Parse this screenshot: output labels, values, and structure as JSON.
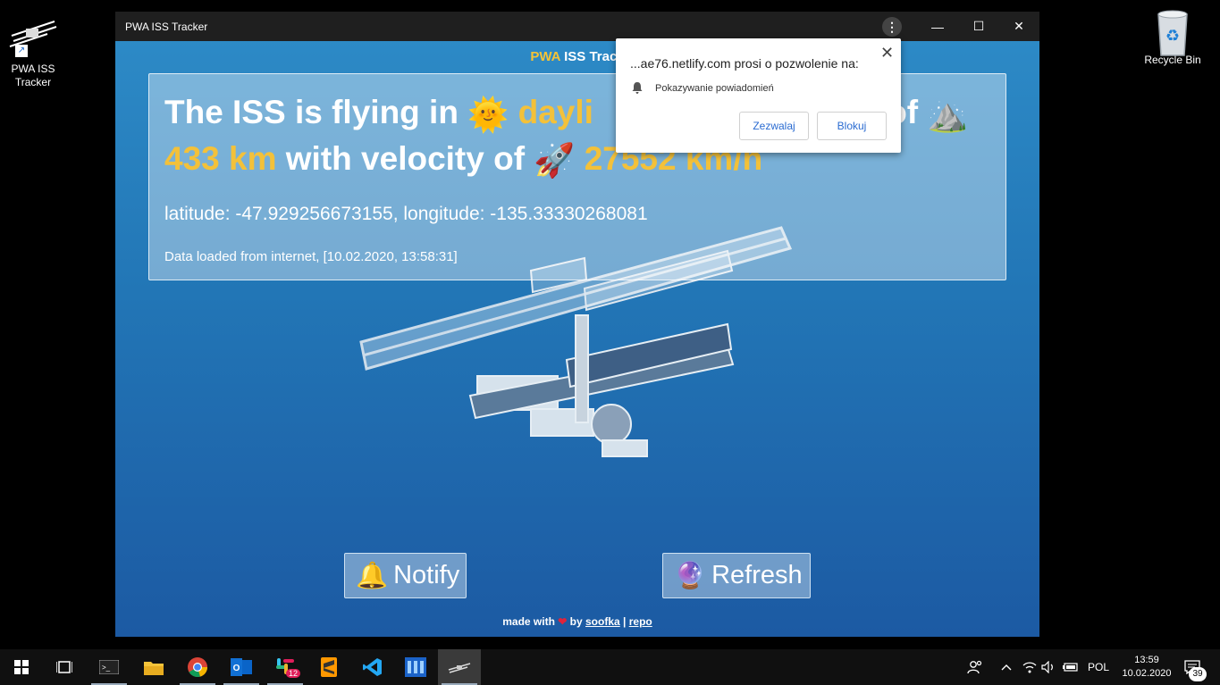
{
  "desktop": {
    "icons": [
      {
        "label_line1": "PWA ISS",
        "label_line2": "Tracker"
      },
      {
        "label_line1": "Recycle Bin"
      }
    ]
  },
  "window": {
    "title": "PWA ISS Tracker",
    "controls": {
      "menu": "⋮",
      "minimize": "—",
      "maximize": "☐",
      "close": "✕"
    }
  },
  "app": {
    "header_prefix": "PWA",
    "header_rest": " ISS Track",
    "headline": {
      "part1": "The ISS is flying in ",
      "daylight_emoji": "🌞",
      "daylight": "dayli",
      "part2": "of ",
      "mountain_emoji": "⛰️",
      "altitude": "433 km",
      "part3": " with velocity of ",
      "rocket_emoji": "🚀",
      "velocity": "27552 km/h"
    },
    "coordinates": "latitude: -47.929256673155, longitude: -135.33330268081",
    "data_loaded": "Data loaded from internet, [10.02.2020, 13:58:31]",
    "buttons": {
      "notify_emoji": "🔔",
      "notify": "Notify",
      "refresh_emoji": "🔮",
      "refresh": "Refresh"
    },
    "footer": {
      "made_with": "made with ",
      "heart": "❤",
      "by": " by ",
      "author": "soofka",
      "sep": " | ",
      "repo": "repo"
    }
  },
  "permission_popup": {
    "title": "...ae76.netlify.com prosi o pozwolenie na:",
    "permission": "Pokazywanie powiadomień",
    "allow": "Zezwalaj",
    "block": "Blokuj",
    "close": "✕"
  },
  "taskbar": {
    "language": "POL",
    "time": "13:59",
    "date": "10.02.2020",
    "notifications_count": "39",
    "slack_badge": "12"
  },
  "colors": {
    "accent_yellow": "#f3c13a",
    "popup_button_text": "#2a6bd1"
  }
}
